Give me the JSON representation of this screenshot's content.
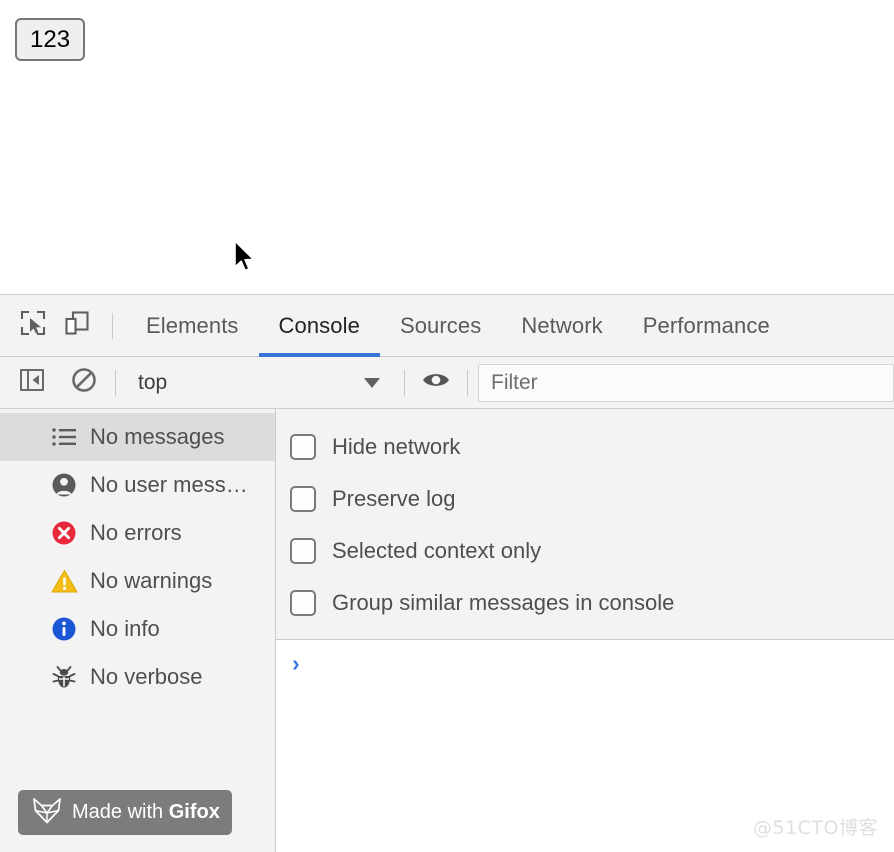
{
  "page": {
    "button_label": "123",
    "cursor": "arrow-pointer"
  },
  "devtools": {
    "toolbar_icons": [
      {
        "name": "inspect-element-icon",
        "title": "Inspect element"
      },
      {
        "name": "device-toolbar-icon",
        "title": "Toggle device toolbar"
      }
    ],
    "tabs": [
      {
        "label": "Elements",
        "active": false
      },
      {
        "label": "Console",
        "active": true
      },
      {
        "label": "Sources",
        "active": false
      },
      {
        "label": "Network",
        "active": false
      },
      {
        "label": "Performance",
        "active": false
      }
    ],
    "active_tab": "Console",
    "accent_color": "#3875d7"
  },
  "console_toolbar": {
    "sidebar_toggle": "show-console-sidebar-icon",
    "clear_console": "clear-console-icon",
    "context": {
      "value": "top",
      "caret": "chevron-down-icon"
    },
    "eye_button": "console-settings-eye-icon",
    "filter": {
      "placeholder": "Filter",
      "value": ""
    }
  },
  "sidebar": {
    "items": [
      {
        "label": "No messages",
        "icon": "list-icon",
        "selected": true
      },
      {
        "label": "No user mess…",
        "icon": "person-icon",
        "selected": false
      },
      {
        "label": "No errors",
        "icon": "error-icon",
        "selected": false
      },
      {
        "label": "No warnings",
        "icon": "warning-icon",
        "selected": false
      },
      {
        "label": "No info",
        "icon": "info-icon",
        "selected": false
      },
      {
        "label": "No verbose",
        "icon": "bug-icon",
        "selected": false
      }
    ]
  },
  "settings": {
    "checkboxes": [
      {
        "label": "Hide network",
        "checked": false
      },
      {
        "label": "Preserve log",
        "checked": false
      },
      {
        "label": "Selected context only",
        "checked": false
      },
      {
        "label": "Group similar messages in console",
        "checked": false
      }
    ]
  },
  "console": {
    "prompt": "›",
    "messages": []
  },
  "badges": {
    "gifox_prefix": "Made with ",
    "gifox_name": "Gifox",
    "gifox_icon": "fox-head-icon"
  },
  "watermark": {
    "text": "@51CTO博客"
  }
}
